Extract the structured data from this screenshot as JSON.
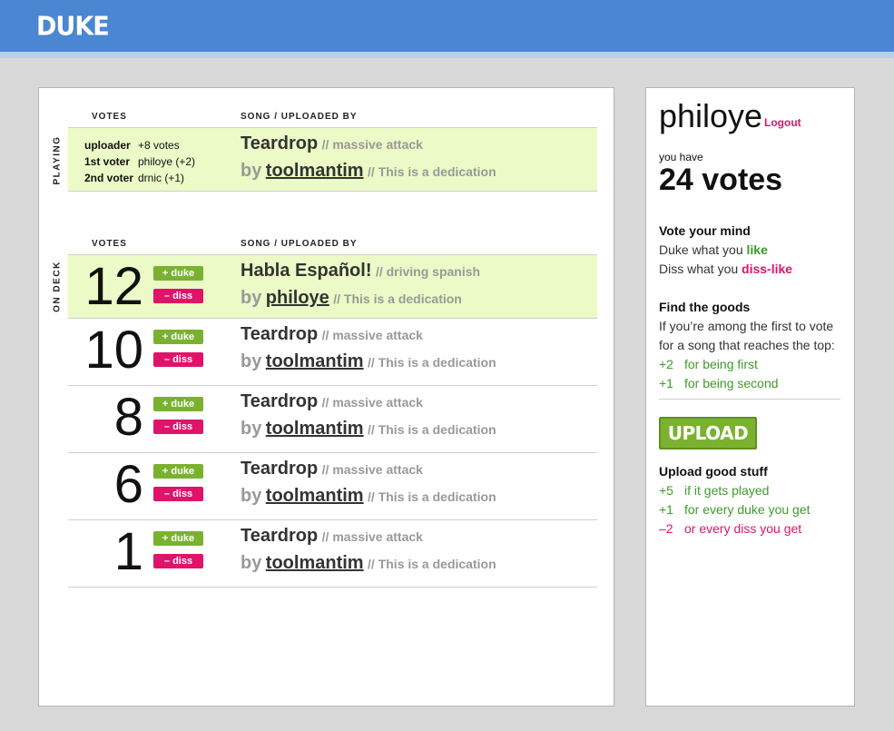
{
  "app": {
    "logo": "DUKE"
  },
  "playing": {
    "label": "PLAYING",
    "headers": {
      "votes": "VOTES",
      "song": "SONG / UPLOADED BY"
    },
    "voters": [
      {
        "role": "uploader",
        "detail": "+8 votes"
      },
      {
        "role": "1st voter",
        "detail": "philoye (+2)"
      },
      {
        "role": "2nd voter",
        "detail": "drnic (+1)"
      }
    ],
    "song": {
      "title": "Teardrop",
      "artist": "// massive attack",
      "by": "by",
      "uploader": "toolmantim",
      "dedication": "// This is a dedication"
    }
  },
  "on_deck": {
    "label": "ON DECK",
    "headers": {
      "votes": "VOTES",
      "song": "SONG / UPLOADED BY"
    },
    "duke_label": "+ duke",
    "diss_label": "– diss",
    "items": [
      {
        "votes": "12",
        "title": "Habla Español!",
        "artist": "// driving spanish",
        "by": "by",
        "uploader": "philoye",
        "dedication": "// This is a dedication"
      },
      {
        "votes": "10",
        "title": "Teardrop",
        "artist": "// massive attack",
        "by": "by",
        "uploader": "toolmantim",
        "dedication": "// This is a dedication"
      },
      {
        "votes": "8",
        "title": "Teardrop",
        "artist": "// massive attack",
        "by": "by",
        "uploader": "toolmantim",
        "dedication": "// This is a dedication"
      },
      {
        "votes": "6",
        "title": "Teardrop",
        "artist": "// massive attack",
        "by": "by",
        "uploader": "toolmantim",
        "dedication": "// This is a dedication"
      },
      {
        "votes": "1",
        "title": "Teardrop",
        "artist": "// massive attack",
        "by": "by",
        "uploader": "toolmantim",
        "dedication": "// This is a dedication"
      }
    ]
  },
  "sidebar": {
    "username": "philoye",
    "logout": "Logout",
    "you_have": "you have",
    "votes": "24 votes",
    "vote_mind": {
      "heading": "Vote your mind",
      "duke_prefix": "Duke what you ",
      "duke_word": "like",
      "diss_prefix": "Diss what you ",
      "diss_word": "diss-like"
    },
    "find_goods": {
      "heading": "Find the goods",
      "line1": "If you’re among the first to vote",
      "line2": "for a song that reaches the top:",
      "rewards": [
        {
          "pts": "+2",
          "text": "for being first"
        },
        {
          "pts": "+1",
          "text": "for being second"
        }
      ]
    },
    "upload_button": "UPLOAD",
    "upload_good": {
      "heading": "Upload good stuff",
      "rewards": [
        {
          "pts": "+5",
          "text": "if it gets played"
        },
        {
          "pts": "+1",
          "text": "for every duke you get"
        },
        {
          "pts": "–2",
          "text": "or every diss you get"
        }
      ]
    },
    "colors": {
      "green": "#3f9a2a",
      "pink": "#e0136a",
      "brand_blue": "#4a86d2"
    }
  }
}
